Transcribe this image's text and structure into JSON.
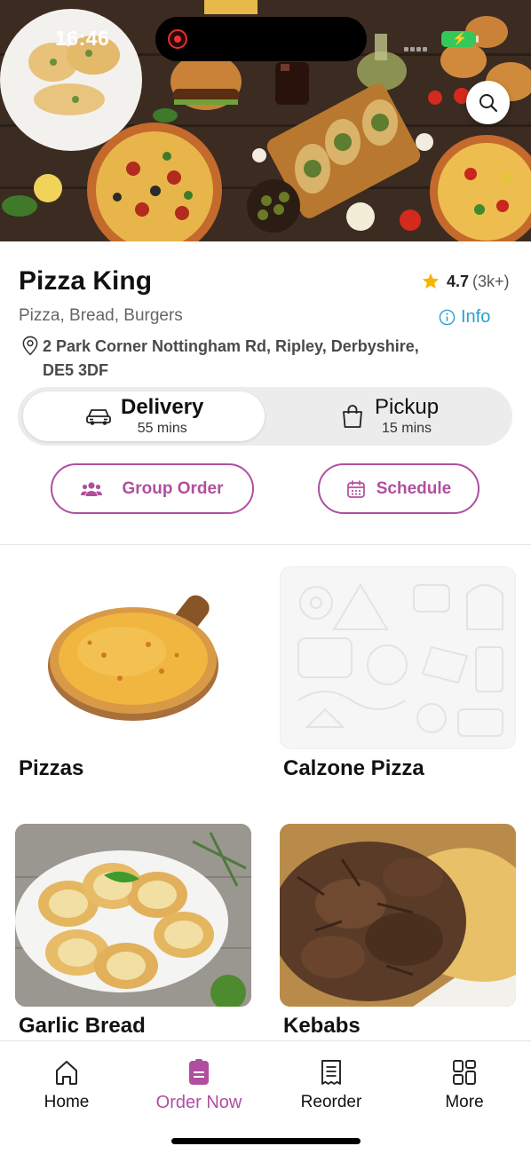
{
  "status_bar": {
    "time": "16:46"
  },
  "hero": {
    "search_icon": "search-icon"
  },
  "restaurant": {
    "name": "Pizza King",
    "rating": "4.7",
    "rating_count": "(3k+)",
    "cuisines": "Pizza, Bread, Burgers",
    "info_label": "Info",
    "address": "2 Park Corner Nottingham Rd, Ripley, Derbyshire, DE5 3DF"
  },
  "order_mode": {
    "delivery": {
      "label": "Delivery",
      "time": "55 mins",
      "selected": true
    },
    "pickup": {
      "label": "Pickup",
      "time": "15 mins",
      "selected": false
    }
  },
  "actions": {
    "group_order": "Group Order",
    "schedule": "Schedule"
  },
  "categories": [
    {
      "name": "Pizzas"
    },
    {
      "name": "Calzone Pizza"
    },
    {
      "name": "Garlic Bread"
    },
    {
      "name": "Kebabs"
    }
  ],
  "bottom_nav": [
    {
      "label": "Home",
      "icon": "home-icon",
      "active": false
    },
    {
      "label": "Order Now",
      "icon": "order-icon",
      "active": true
    },
    {
      "label": "Reorder",
      "icon": "receipt-icon",
      "active": false
    },
    {
      "label": "More",
      "icon": "grid-icon",
      "active": false
    }
  ],
  "colors": {
    "accent": "#b14f9f",
    "info_link": "#2a9fd0",
    "star": "#f4b400",
    "toggle_bg": "#ececec"
  }
}
